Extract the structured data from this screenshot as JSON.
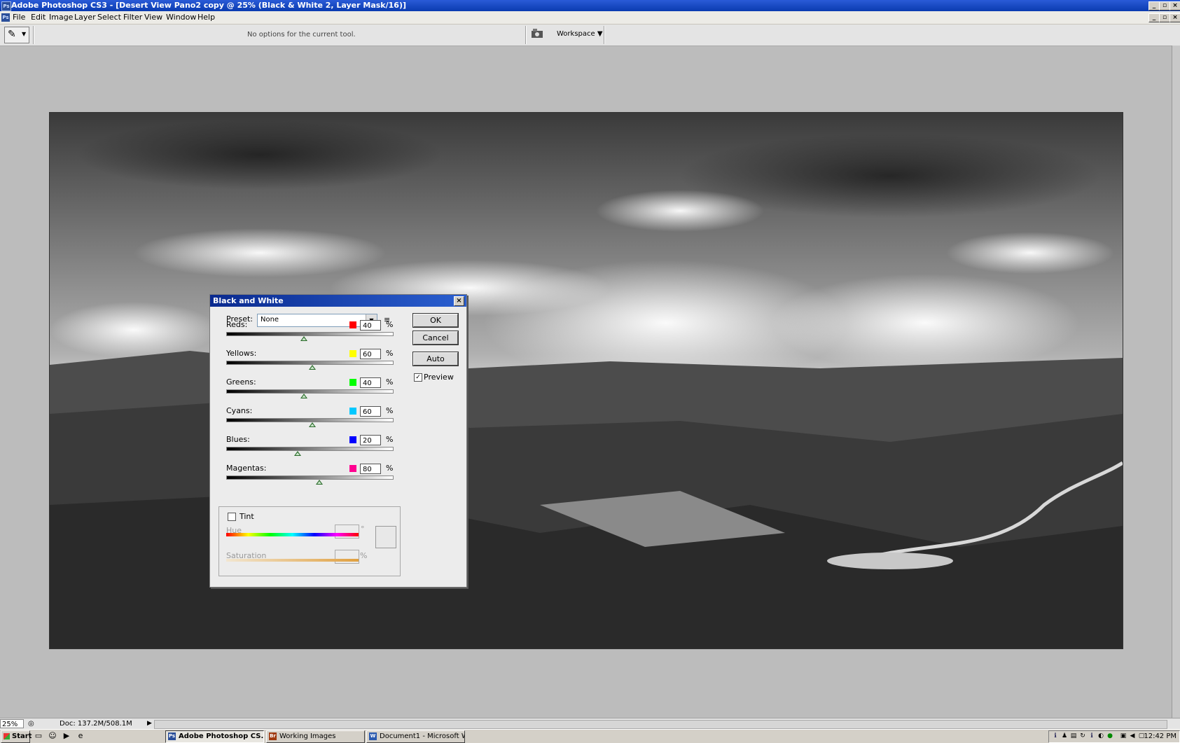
{
  "window": {
    "title": "Adobe Photoshop CS3 - [Desert View Pano2 copy @ 25% (Black & White 2, Layer Mask/16)]",
    "app_icon": "Ps"
  },
  "menu": {
    "items": [
      "File",
      "Edit",
      "Image",
      "Layer",
      "Select",
      "Filter",
      "View",
      "Window",
      "Help"
    ]
  },
  "options_bar": {
    "message": "No options for the current tool.",
    "workspace_label": "Workspace"
  },
  "dialog": {
    "title": "Black and White",
    "preset_label": "Preset:",
    "preset_value": "None",
    "sliders": [
      {
        "label": "Reds:",
        "value": "40",
        "swatch": "#ff0000",
        "level": 0.47
      },
      {
        "label": "Yellows:",
        "value": "60",
        "swatch": "#ffff00",
        "level": 0.52
      },
      {
        "label": "Greens:",
        "value": "40",
        "swatch": "#00ff00",
        "level": 0.47
      },
      {
        "label": "Cyans:",
        "value": "60",
        "swatch": "#00c8ff",
        "level": 0.52
      },
      {
        "label": "Blues:",
        "value": "20",
        "swatch": "#0000ff",
        "level": 0.43
      },
      {
        "label": "Magentas:",
        "value": "80",
        "swatch": "#ff0090",
        "level": 0.56
      }
    ],
    "percent": "%",
    "ok_label": "OK",
    "cancel_label": "Cancel",
    "auto_label": "Auto",
    "preview_label": "Preview",
    "preview_checked": true,
    "tint_label": "Tint",
    "tint_checked": false,
    "hue_label": "Hue",
    "hue_unit": "°",
    "saturation_label": "Saturation",
    "saturation_unit": "%"
  },
  "status": {
    "zoom": "25%",
    "doc_info": "Doc: 137.2M/508.1M"
  },
  "taskbar": {
    "start_label": "Start",
    "tasks": [
      {
        "label": "Adobe Photoshop CS...",
        "icon": "Ps",
        "color": "#2b4f9a",
        "active": true
      },
      {
        "label": "Working Images",
        "icon": "Br",
        "color": "#a03a10",
        "active": false
      },
      {
        "label": "Document1 - Microsoft W...",
        "icon": "W",
        "color": "#2a5ab0",
        "active": false
      }
    ],
    "clock": "12:42 PM"
  }
}
